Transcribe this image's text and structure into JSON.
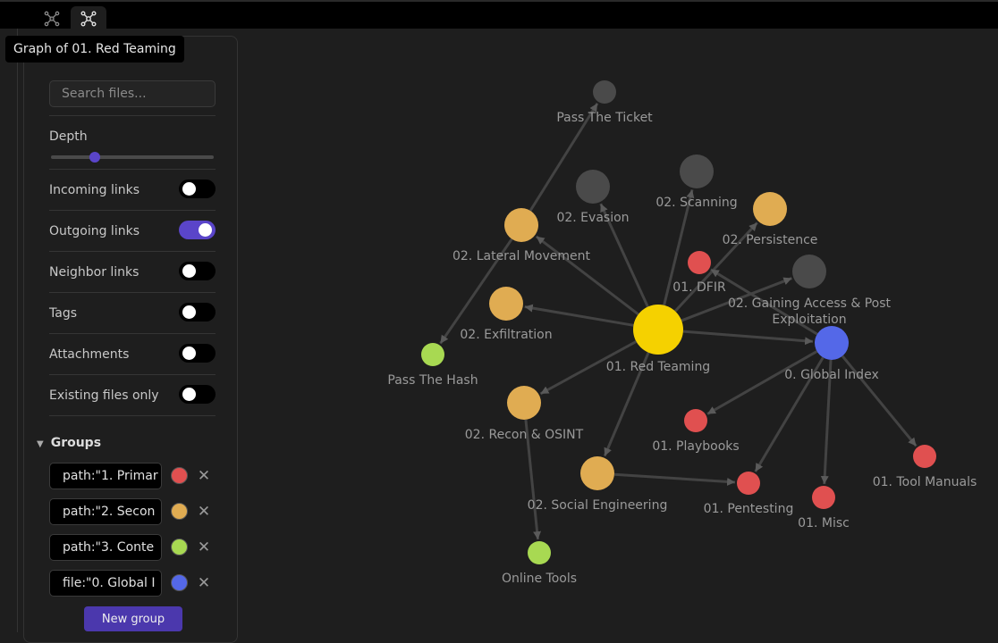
{
  "tooltip": "Graph of 01. Red Teaming",
  "tabs": [
    {
      "icon": "graph-icon"
    },
    {
      "icon": "local-graph-icon",
      "active": true
    }
  ],
  "filters": {
    "search_placeholder": "Search files...",
    "depth_label": "Depth",
    "depth_value_fraction": 0.27,
    "toggles": [
      {
        "label": "Incoming links",
        "on": false
      },
      {
        "label": "Outgoing links",
        "on": true
      },
      {
        "label": "Neighbor links",
        "on": false
      },
      {
        "label": "Tags",
        "on": false
      },
      {
        "label": "Attachments",
        "on": false
      },
      {
        "label": "Existing files only",
        "on": false
      }
    ]
  },
  "groups": {
    "title": "Groups",
    "items": [
      {
        "query": "path:\"1. Primar",
        "color": "#e05050"
      },
      {
        "query": "path:\"2. Secon",
        "color": "#e0ac52"
      },
      {
        "query": "path:\"3. Conte",
        "color": "#a8d952"
      },
      {
        "query": "file:\"0. Global I",
        "color": "#5468e8"
      }
    ],
    "remove_symbol": "✕",
    "new_group_label": "New group"
  },
  "colors": {
    "red": "#e05050",
    "orange": "#e0ac52",
    "green": "#a8d952",
    "blue": "#5468e8",
    "gray": "#4a4a4a",
    "yellow": "#f5d100",
    "accent": "#5a45c9"
  },
  "graph": {
    "nodes": [
      {
        "id": "red-teaming",
        "label": "01. Red Teaming",
        "color": "yellow"
      },
      {
        "id": "global-index",
        "label": "0. Global Index",
        "color": "blue"
      },
      {
        "id": "pass-ticket",
        "label": "Pass The Ticket",
        "color": "gray"
      },
      {
        "id": "evasion",
        "label": "02. Evasion",
        "color": "gray"
      },
      {
        "id": "scanning",
        "label": "02. Scanning",
        "color": "gray"
      },
      {
        "id": "persistence",
        "label": "02. Persistence",
        "color": "orange"
      },
      {
        "id": "lateral",
        "label": "02. Lateral Movement",
        "color": "orange"
      },
      {
        "id": "dfir",
        "label": "01. DFIR",
        "color": "red"
      },
      {
        "id": "gaining",
        "label": "02. Gaining Access & Post",
        "label2": "Exploitation",
        "color": "gray"
      },
      {
        "id": "exfil",
        "label": "02. Exfiltration",
        "color": "orange"
      },
      {
        "id": "pass-hash",
        "label": "Pass The Hash",
        "color": "green"
      },
      {
        "id": "recon",
        "label": "02. Recon & OSINT",
        "color": "orange"
      },
      {
        "id": "playbooks",
        "label": "01. Playbooks",
        "color": "red"
      },
      {
        "id": "tool-manuals",
        "label": "01. Tool Manuals",
        "color": "red"
      },
      {
        "id": "social",
        "label": "02. Social Engineering",
        "color": "orange"
      },
      {
        "id": "pentesting",
        "label": "01. Pentesting",
        "color": "red"
      },
      {
        "id": "misc",
        "label": "01. Misc",
        "color": "red"
      },
      {
        "id": "online-tools",
        "label": "Online Tools",
        "color": "green"
      }
    ],
    "edges": [
      [
        "red-teaming",
        "evasion"
      ],
      [
        "red-teaming",
        "scanning"
      ],
      [
        "red-teaming",
        "lateral"
      ],
      [
        "red-teaming",
        "gaining"
      ],
      [
        "red-teaming",
        "exfil"
      ],
      [
        "red-teaming",
        "recon"
      ],
      [
        "red-teaming",
        "social"
      ],
      [
        "red-teaming",
        "global-index"
      ],
      [
        "red-teaming",
        "persistence"
      ],
      [
        "global-index",
        "dfir"
      ],
      [
        "global-index",
        "playbooks"
      ],
      [
        "global-index",
        "pentesting"
      ],
      [
        "global-index",
        "misc"
      ],
      [
        "global-index",
        "tool-manuals"
      ],
      [
        "lateral",
        "pass-ticket"
      ],
      [
        "lateral",
        "pass-hash"
      ],
      [
        "recon",
        "online-tools"
      ],
      [
        "social",
        "pentesting"
      ]
    ]
  }
}
